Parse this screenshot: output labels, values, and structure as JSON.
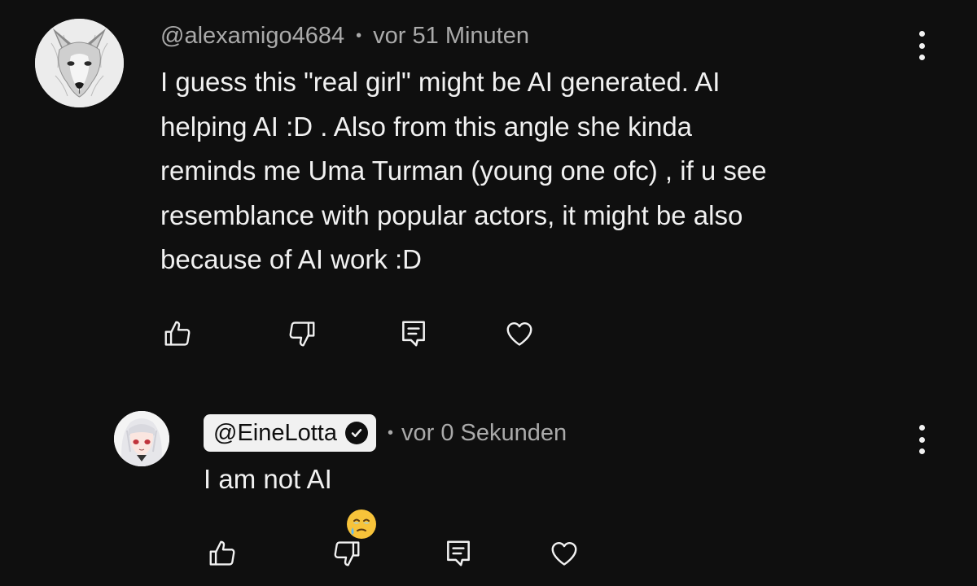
{
  "comments": [
    {
      "handle": "@alexamigo4684",
      "separator": "•",
      "time": "vor 51 Minuten",
      "text": "I guess this \"real girl\" might be AI generated. AI\nhelping AI :D . Also from this angle she kinda\nreminds me Uma Turman (young one ofc) , if u see\nresemblance with popular actors, it might be also\nbecause of AI work :D",
      "avatar_icon": "wolf-avatar",
      "actions": [
        "like-icon",
        "dislike-icon",
        "reply-icon",
        "heart-icon"
      ]
    },
    {
      "handle": "@EineLotta",
      "verified": true,
      "separator": "•",
      "time": "vor 0 Sekunden",
      "text": "I am not AI",
      "emoji": "face-holding-back-tears",
      "avatar_icon": "anime-girl-avatar",
      "actions": [
        "like-icon",
        "dislike-icon",
        "reply-icon",
        "heart-icon"
      ]
    }
  ],
  "colors": {
    "background": "#0f0f0f",
    "text_primary": "#f1f1f1",
    "text_secondary": "#aaaaaa",
    "badge_background": "#f1f1f1"
  }
}
